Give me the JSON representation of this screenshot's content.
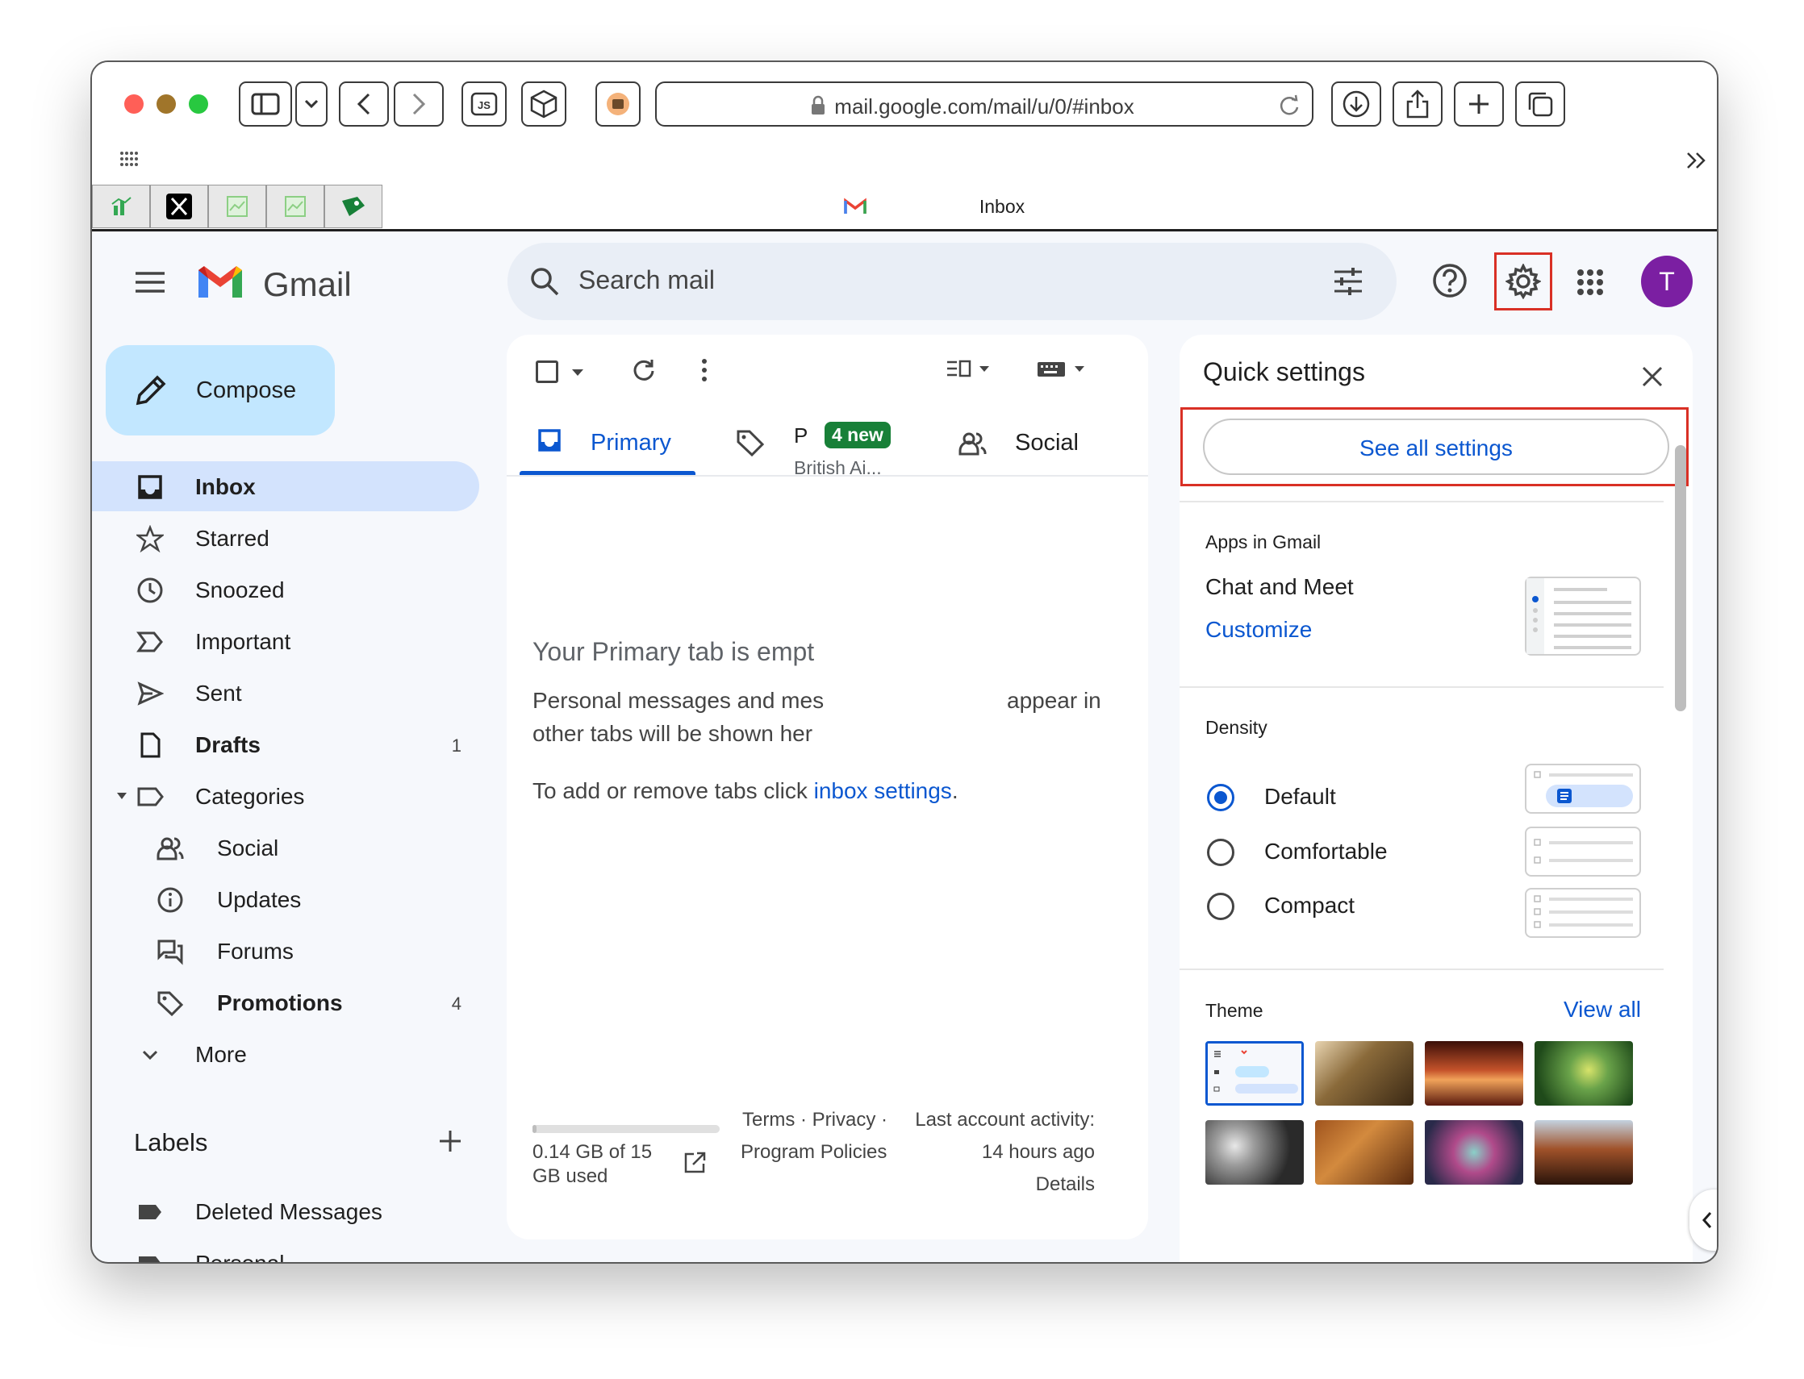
{
  "browser": {
    "url": "mail.google.com/mail/u/0/#inbox",
    "tab_title": "Inbox",
    "bookmarks": [
      "bookmark-chart-icon",
      "x-logo-icon",
      "sheet-icon",
      "sheet-icon",
      "tag-icon"
    ]
  },
  "header": {
    "app_name": "Gmail",
    "search_placeholder": "Search mail",
    "avatar_letter": "T"
  },
  "sidebar": {
    "compose_label": "Compose",
    "items": [
      {
        "label": "Inbox",
        "count": "",
        "icon": "inbox-icon",
        "active": true,
        "bold": true
      },
      {
        "label": "Starred",
        "count": "",
        "icon": "star-icon"
      },
      {
        "label": "Snoozed",
        "count": "",
        "icon": "clock-icon"
      },
      {
        "label": "Important",
        "count": "",
        "icon": "important-icon"
      },
      {
        "label": "Sent",
        "count": "",
        "icon": "send-icon"
      },
      {
        "label": "Drafts",
        "count": "1",
        "icon": "draft-icon",
        "bold": true
      },
      {
        "label": "Categories",
        "count": "",
        "icon": "label-icon"
      },
      {
        "label": "Social",
        "count": "",
        "icon": "people-icon",
        "indent": true
      },
      {
        "label": "Updates",
        "count": "",
        "icon": "info-icon",
        "indent": true
      },
      {
        "label": "Forums",
        "count": "",
        "icon": "forum-icon",
        "indent": true
      },
      {
        "label": "Promotions",
        "count": "4",
        "icon": "tag-icon",
        "indent": true,
        "bold": true
      },
      {
        "label": "More",
        "count": "",
        "icon": "chevron-down-icon"
      }
    ],
    "labels_heading": "Labels",
    "labels": [
      "Deleted Messages",
      "Personal"
    ]
  },
  "mail": {
    "tabs": [
      {
        "label": "Primary"
      },
      {
        "label": "P",
        "badge": "4 new",
        "sub": "British Ai..."
      },
      {
        "label": "Social"
      }
    ],
    "empty_title": "Your Primary tab is empt",
    "empty_line1a": "Personal messages and mes",
    "empty_line1b": "appear in",
    "empty_line2": "other tabs will be shown her",
    "empty_line3": "To add or remove tabs click ",
    "empty_link": "inbox settings",
    "empty_line3_end": ".",
    "storage_line1": "0.14 GB of 15",
    "storage_line2": "GB used",
    "storage_fraction": 0.01,
    "footer_terms": "Terms · Privacy ·",
    "footer_policies": "Program Policies",
    "activity_label": "Last account activity:",
    "activity_time": "14 hours ago",
    "activity_details": "Details"
  },
  "quick_settings": {
    "title": "Quick settings",
    "see_all": "See all settings",
    "apps_heading": "Apps in Gmail",
    "apps_value": "Chat and Meet",
    "customize": "Customize",
    "density_heading": "Density",
    "density_options": [
      "Default",
      "Comfortable",
      "Compact"
    ],
    "density_selected": "Default",
    "theme_heading": "Theme",
    "theme_view_all": "View all"
  },
  "colors": {
    "accent": "#0b57d0",
    "compose_bg": "#c2e7ff",
    "active_nav": "#d3e3fd",
    "highlight": "#d93025",
    "badge": "#188038",
    "avatar": "#7b1fa2"
  }
}
